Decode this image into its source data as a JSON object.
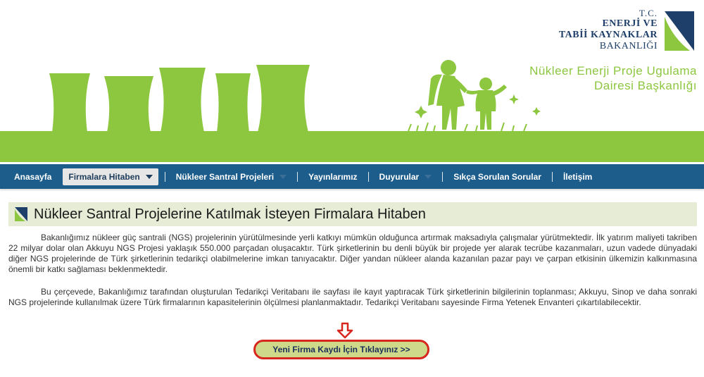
{
  "logo": {
    "tc": "T.C.",
    "line1": "ENERJİ VE",
    "line2": "TABİİ KAYNAKLAR",
    "line3": "BAKANLIĞI"
  },
  "department": {
    "line1": "Nükleer Enerji Proje Ugulama",
    "line2": "Dairesi Başkanlığı"
  },
  "nav": {
    "items": [
      {
        "label": "Anasayfa"
      },
      {
        "label": "Firmalara Hitaben"
      },
      {
        "label": "Nükleer Santral Projeleri"
      },
      {
        "label": "Yayınlarımız"
      },
      {
        "label": "Duyurular"
      },
      {
        "label": "Sıkça Sorulan Sorular"
      },
      {
        "label": "İletişim"
      }
    ]
  },
  "page": {
    "title": "Nükleer Santral Projelerine Katılmak İsteyen Firmalara Hitaben",
    "paragraph1": "Bakanlığımız nükleer güç santrali (NGS) projelerinin yürütülmesinde yerli katkıyı mümkün olduğunca artırmak maksadıyla çalışmalar yürütmektedir. İlk yatırım maliyeti takriben 22 milyar dolar olan Akkuyu NGS Projesi yaklaşık 550.000 parçadan oluşacaktır. Türk şirketlerinin bu denli büyük bir projede yer alarak tecrübe kazanmaları, uzun vadede dünyadaki diğer NGS projelerinde de Türk şirketlerinin tedarikçi olabilmelerine imkan tanıyacaktır. Diğer yandan nükleer alanda kazanılan pazar payı ve çarpan etkisinin ülkemizin kalkınmasına önemli bir katkı sağlaması beklenmektedir.",
    "paragraph2": "Bu çerçevede, Bakanlığımız tarafından oluşturulan Tedarikçi Veritabanı ile sayfası ile kayıt yaptıracak Türk şirketlerinin bilgilerinin toplanması; Akkuyu, Sinop ve daha sonraki NGS projelerinde kullanılmak üzere Türk firmalarının kapasitelerinin ölçülmesi planlanmaktadır. Tedarikçi Veritabanı sayesinde Firma Yetenek Envanteri çıkartılabilecektir.",
    "cta_label": "Yeni Firma Kaydı İçin Tıklayınız >>"
  },
  "colors": {
    "brand_green": "#8dc63f",
    "nav_blue": "#1d5d8c",
    "cta_border": "#d7261e",
    "cta_fill": "#cfd98a",
    "heading_bg": "#e6ecd6",
    "logo_navy": "#1f3f6b"
  },
  "icons": {
    "logo": "ministry-logo-icon",
    "heading": "ministry-small-logo-icon",
    "arrow": "arrow-down-icon",
    "dropdown": "chevron-down-icon"
  }
}
